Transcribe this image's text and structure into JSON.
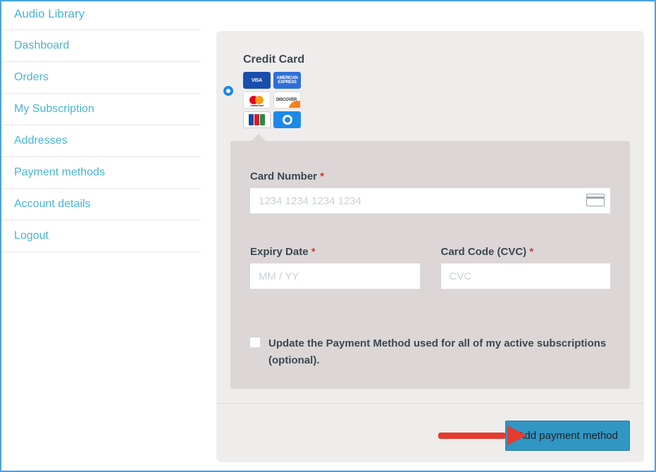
{
  "sidebar": {
    "title": "Audio Library",
    "items": [
      {
        "label": "Dashboard"
      },
      {
        "label": "Orders"
      },
      {
        "label": "My Subscription"
      },
      {
        "label": "Addresses"
      },
      {
        "label": "Payment methods"
      },
      {
        "label": "Account details"
      },
      {
        "label": "Logout"
      }
    ]
  },
  "main": {
    "method_title": "Credit Card",
    "cards": {
      "visa": "VISA",
      "amex": "AMERICAN EXPRESS",
      "mc": "mastercard",
      "discover": "DISCOVER"
    },
    "form": {
      "card_number_label": "Card Number",
      "card_number_placeholder": "1234 1234 1234 1234",
      "expiry_label": "Expiry Date",
      "expiry_placeholder": "MM / YY",
      "cvc_label": "Card Code (CVC)",
      "cvc_placeholder": "CVC",
      "required_mark": "*",
      "update_text": "Update the Payment Method used for all of my active subscriptions (optional)."
    },
    "submit_label": "Add payment method"
  }
}
